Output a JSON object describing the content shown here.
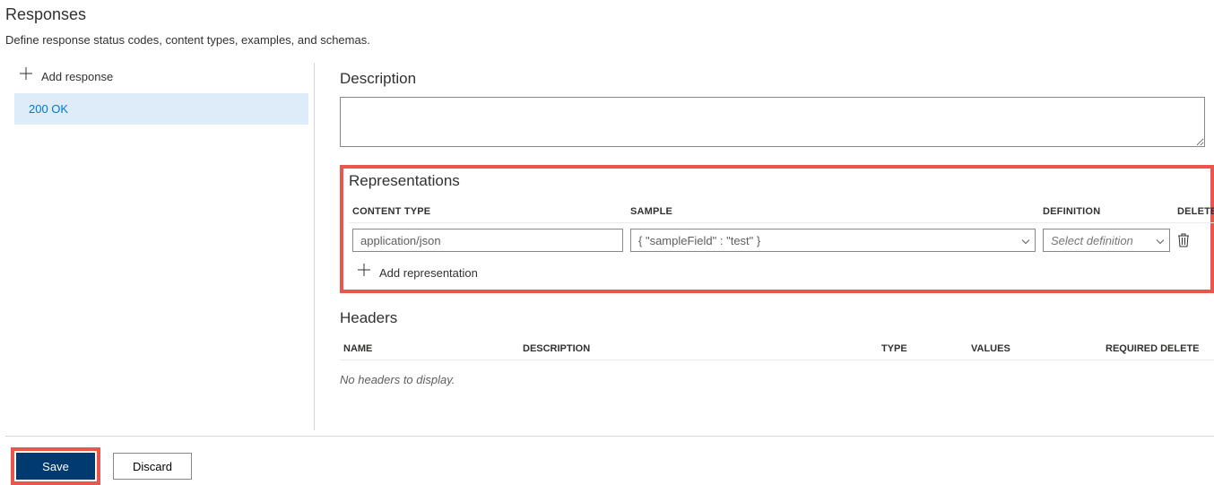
{
  "page": {
    "title": "Responses",
    "subtitle": "Define response status codes, content types, examples, and schemas."
  },
  "sidebar": {
    "add_label": "Add response",
    "items": [
      {
        "label": "200 OK"
      }
    ]
  },
  "description": {
    "title": "Description",
    "value": ""
  },
  "representations": {
    "title": "Representations",
    "columns": {
      "content_type": "CONTENT TYPE",
      "sample": "SAMPLE",
      "definition": "DEFINITION",
      "delete": "DELETE"
    },
    "rows": [
      {
        "content_type": "application/json",
        "sample": "{ \"sampleField\" : \"test\" }",
        "definition_placeholder": "Select definition"
      }
    ],
    "add_label": "Add representation"
  },
  "headers": {
    "title": "Headers",
    "columns": {
      "name": "NAME",
      "description": "DESCRIPTION",
      "type": "TYPE",
      "values": "VALUES",
      "required_delete": "REQUIRED DELETE"
    },
    "empty": "No headers to display."
  },
  "footer": {
    "save": "Save",
    "discard": "Discard"
  }
}
